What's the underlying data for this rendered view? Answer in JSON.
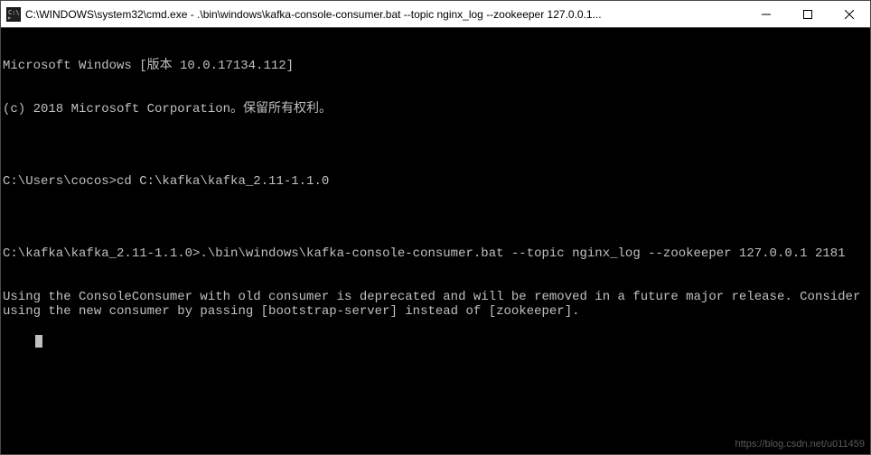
{
  "titlebar": {
    "title": "C:\\WINDOWS\\system32\\cmd.exe - .\\bin\\windows\\kafka-console-consumer.bat  --topic nginx_log --zookeeper 127.0.0.1...",
    "icon": "cmd-icon"
  },
  "window_controls": {
    "minimize": "minimize",
    "maximize": "maximize",
    "close": "close"
  },
  "terminal": {
    "lines": [
      "Microsoft Windows [版本 10.0.17134.112]",
      "(c) 2018 Microsoft Corporation。保留所有权利。",
      "",
      "C:\\Users\\cocos>cd C:\\kafka\\kafka_2.11-1.1.0",
      "",
      "C:\\kafka\\kafka_2.11-1.1.0>.\\bin\\windows\\kafka-console-consumer.bat --topic nginx_log --zookeeper 127.0.0.1 2181",
      "Using the ConsoleConsumer with old consumer is deprecated and will be removed in a future major release. Consider using the new consumer by passing [bootstrap-server] instead of [zookeeper]."
    ],
    "watermark": "https://blog.csdn.net/u011459"
  },
  "colors": {
    "terminal_bg": "#000000",
    "terminal_fg": "#c0c0c0",
    "titlebar_bg": "#ffffff",
    "titlebar_fg": "#000000"
  }
}
